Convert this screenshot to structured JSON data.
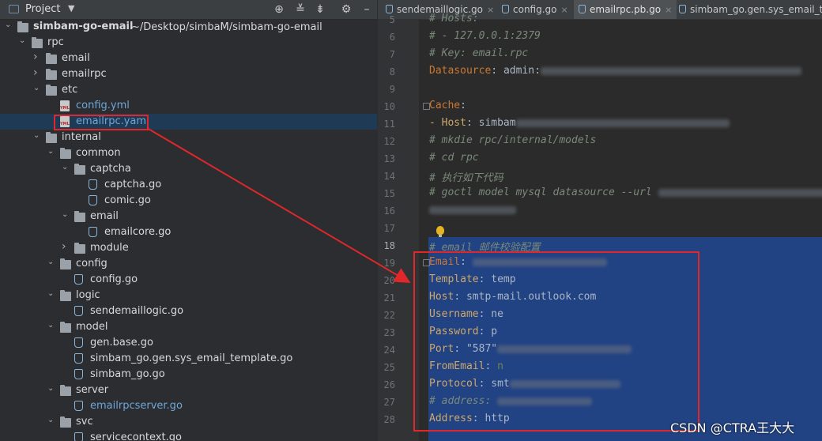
{
  "project_panel": {
    "title": "Project",
    "header_buttons": [
      "crosshair-icon",
      "collapse-all-icon",
      "expand-all-icon",
      "gear-icon",
      "minimize-icon"
    ],
    "tree": [
      {
        "label": "simbam-go-email",
        "hint": "~/Desktop/simbaM/simbam-go-email",
        "type": "folder",
        "expanded": true
      },
      {
        "label": "rpc",
        "type": "folder",
        "expanded": true
      },
      {
        "label": "email",
        "type": "folder",
        "expanded": false
      },
      {
        "label": "emailrpc",
        "type": "folder",
        "expanded": false
      },
      {
        "label": "etc",
        "type": "folder",
        "expanded": true
      },
      {
        "label": "config.yml",
        "type": "yml"
      },
      {
        "label": "emailrpc.yaml",
        "type": "yml",
        "selected": true
      },
      {
        "label": "internal",
        "type": "folder",
        "expanded": true
      },
      {
        "label": "common",
        "type": "folder",
        "expanded": true
      },
      {
        "label": "captcha",
        "type": "folder",
        "expanded": true
      },
      {
        "label": "captcha.go",
        "type": "go"
      },
      {
        "label": "comic.go",
        "type": "go"
      },
      {
        "label": "email",
        "type": "folder",
        "expanded": true
      },
      {
        "label": "emailcore.go",
        "type": "go"
      },
      {
        "label": "module",
        "type": "folder",
        "expanded": false
      },
      {
        "label": "config",
        "type": "folder",
        "expanded": true
      },
      {
        "label": "config.go",
        "type": "go"
      },
      {
        "label": "logic",
        "type": "folder",
        "expanded": true
      },
      {
        "label": "sendemaillogic.go",
        "type": "go"
      },
      {
        "label": "model",
        "type": "folder",
        "expanded": true
      },
      {
        "label": "gen.base.go",
        "type": "go"
      },
      {
        "label": "simbam_go.gen.sys_email_template.go",
        "type": "go"
      },
      {
        "label": "simbam_go.go",
        "type": "go"
      },
      {
        "label": "server",
        "type": "folder",
        "expanded": true
      },
      {
        "label": "emailrpcserver.go",
        "type": "go"
      },
      {
        "label": "svc",
        "type": "folder",
        "expanded": true
      },
      {
        "label": "servicecontext.go",
        "type": "go"
      }
    ]
  },
  "editor": {
    "tabs": [
      {
        "label": "sendemaillogic.go",
        "active": false
      },
      {
        "label": "config.go",
        "active": false
      },
      {
        "label": "emailrpc.pb.go",
        "active": true
      },
      {
        "label": "simbam_go.gen.sys_email_tem",
        "active": false
      }
    ],
    "lines": [
      {
        "n": "5",
        "text": "#  Hosts:"
      },
      {
        "n": "6",
        "text": "#  - 127.0.0.1:2379"
      },
      {
        "n": "7",
        "text": "#  Key: email.rpc"
      },
      {
        "n": "8",
        "key": "Datasource",
        "val": "admin:"
      },
      {
        "n": "9",
        "text": ""
      },
      {
        "n": "10",
        "key": "Cache",
        "val": ""
      },
      {
        "n": "11",
        "key": "  - Host",
        "val": "simbam"
      },
      {
        "n": "12",
        "text": "#  mkdie rpc/internal/models"
      },
      {
        "n": "13",
        "text": "#  cd rpc"
      },
      {
        "n": "14",
        "text": "#  执行如下代码"
      },
      {
        "n": "15",
        "text": "#  goctl model mysql datasource --url "
      },
      {
        "n": "16",
        "text": ""
      },
      {
        "n": "17",
        "text": ""
      },
      {
        "n": "18",
        "text": "# email 邮件校验配置"
      },
      {
        "n": "19",
        "key": "Email",
        "val": ""
      },
      {
        "n": "20",
        "key": "  Template",
        "val": "temp"
      },
      {
        "n": "21",
        "key": "  Host",
        "val": "smtp-mail.outlook.com"
      },
      {
        "n": "22",
        "key": "  Username",
        "val": "ne"
      },
      {
        "n": "23",
        "key": "  Password",
        "val": "p"
      },
      {
        "n": "24",
        "key": "  Port",
        "val": "\"587\""
      },
      {
        "n": "25",
        "key": "  FromEmail",
        "val": "n"
      },
      {
        "n": "26",
        "key": "  Protocol",
        "val": "smt"
      },
      {
        "n": "27",
        "text": "  # address: "
      },
      {
        "n": "28",
        "key": "  Address",
        "val": "http"
      }
    ]
  },
  "watermark": "CSDN @CTRA王大大",
  "colors": {
    "selection": "#214283",
    "annotation": "#e0282a",
    "tree_selected": "#1f3a55"
  }
}
